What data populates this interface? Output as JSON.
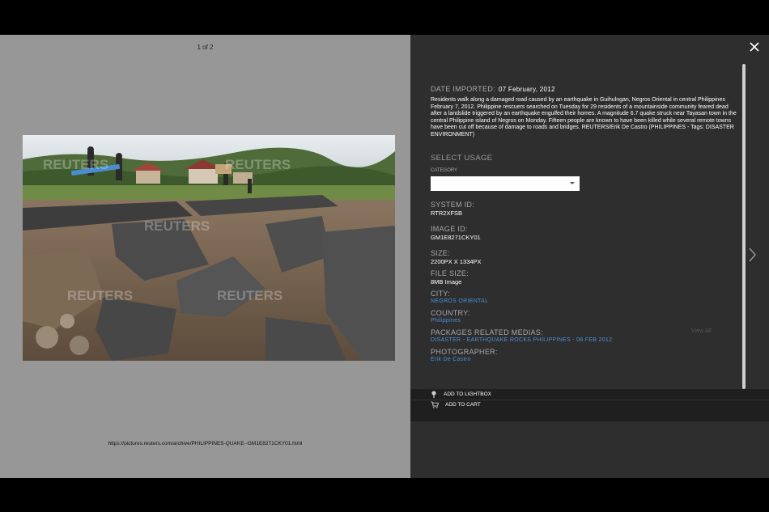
{
  "viewer": {
    "counter": "1 of 2",
    "url": "https://pictures.reuters.com/archive/PHILIPPINES-QUAKE--GM1E8271CKY01.html",
    "watermark": "REUTERS"
  },
  "details": {
    "date_label": "DATE IMPORTED:",
    "date_value": "07 February, 2012",
    "caption": "Residents walk along a damaged road caused by an earthquake in Guihulngan, Negros Oriental in central Philippines February 7, 2012. Philippine rescuers searched on Tuesday for 29 residents of a mountainside community feared dead after a landslide triggered by an earthquake engulfed their homes. A magnitude 6.7 quake struck near Tayasan town in the central Philippine island of Negros on Monday. Fifteen people are known to have been killed while several remote towns have been cut off because of damage to roads and bridges. REUTERS/Erik De Castro (PHILIPPINES - Tags: DISASTER ENVIRONMENT)",
    "usage_title": "SELECT USAGE",
    "category_label": "CATEGORY",
    "category_value": "",
    "system_id_label": "SYSTEM ID:",
    "system_id": "RTR2XFSB",
    "image_id_label": "IMAGE ID:",
    "image_id": "GM1E8271CKY01",
    "size_label": "SIZE:",
    "size": "2200PX X 1334PX",
    "file_size_label": "FILE SIZE:",
    "file_size": "8MB Image",
    "city_label": "CITY:",
    "city": "NEGROS ORIENTAL",
    "country_label": "COUNTRY:",
    "country": "Philippines",
    "packages_label": "PACKAGES RELATED MEDIAS:",
    "packages_link": "DISASTER - EARTHQUAKE ROCKS PHILIPPINES - 08 FEB 2012",
    "view_all": "View All",
    "photographer_label": "PHOTOGRAPHER:",
    "photographer": "Erik De Castro"
  },
  "actions": {
    "lightbox": "ADD TO LIGHTBOX",
    "cart": "ADD TO CART"
  },
  "icons": {
    "close": "close-icon",
    "next": "chevron-right-icon",
    "lightbox": "pin-icon",
    "cart": "cart-icon"
  }
}
